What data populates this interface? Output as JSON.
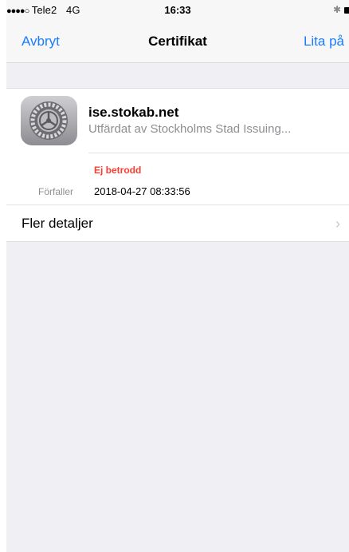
{
  "status_bar": {
    "signal_dots": "●●●●○",
    "carrier": "Tele2",
    "network": "4G",
    "time": "16:33",
    "bluetooth_icon": "bluetooth-icon",
    "battery_icon": "battery-icon"
  },
  "nav": {
    "cancel_label": "Avbryt",
    "title": "Certifikat",
    "trust_label": "Lita på"
  },
  "certificate": {
    "icon": "settings-gear-icon",
    "name": "ise.stokab.net",
    "issuer": "Utfärdat av Stockholms Stad Issuing...",
    "trust_status": "Ej betrodd",
    "trust_status_color": "#ff3b30",
    "expires_label": "Förfaller",
    "expires_value": "2018-04-27 08:33:56"
  },
  "details": {
    "label": "Fler detaljer",
    "chevron": "›"
  },
  "colors": {
    "accent": "#1a7cff",
    "background": "#efeff4"
  }
}
